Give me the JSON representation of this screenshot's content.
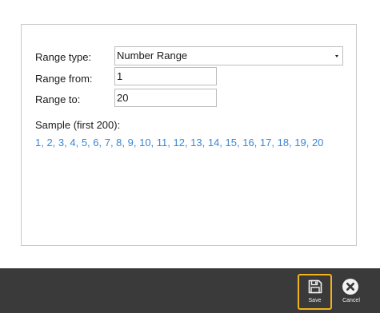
{
  "form": {
    "range_type_label": "Range type:",
    "range_type_value": "Number Range",
    "range_from_label": "Range from:",
    "range_from_value": "1",
    "range_to_label": "Range to:",
    "range_to_value": "20",
    "sample_title": "Sample (first 200):",
    "sample_values": "1, 2, 3, 4, 5, 6, 7, 8, 9, 10, 11, 12, 13, 14, 15, 16, 17, 18, 19, 20"
  },
  "toolbar": {
    "save_label": "Save",
    "save_icon": "save-icon",
    "cancel_label": "Cancel",
    "cancel_icon": "close-icon",
    "accent": "#f2b21c",
    "background": "#3a3a3a"
  },
  "colors": {
    "sample_text": "#3a86d6"
  }
}
